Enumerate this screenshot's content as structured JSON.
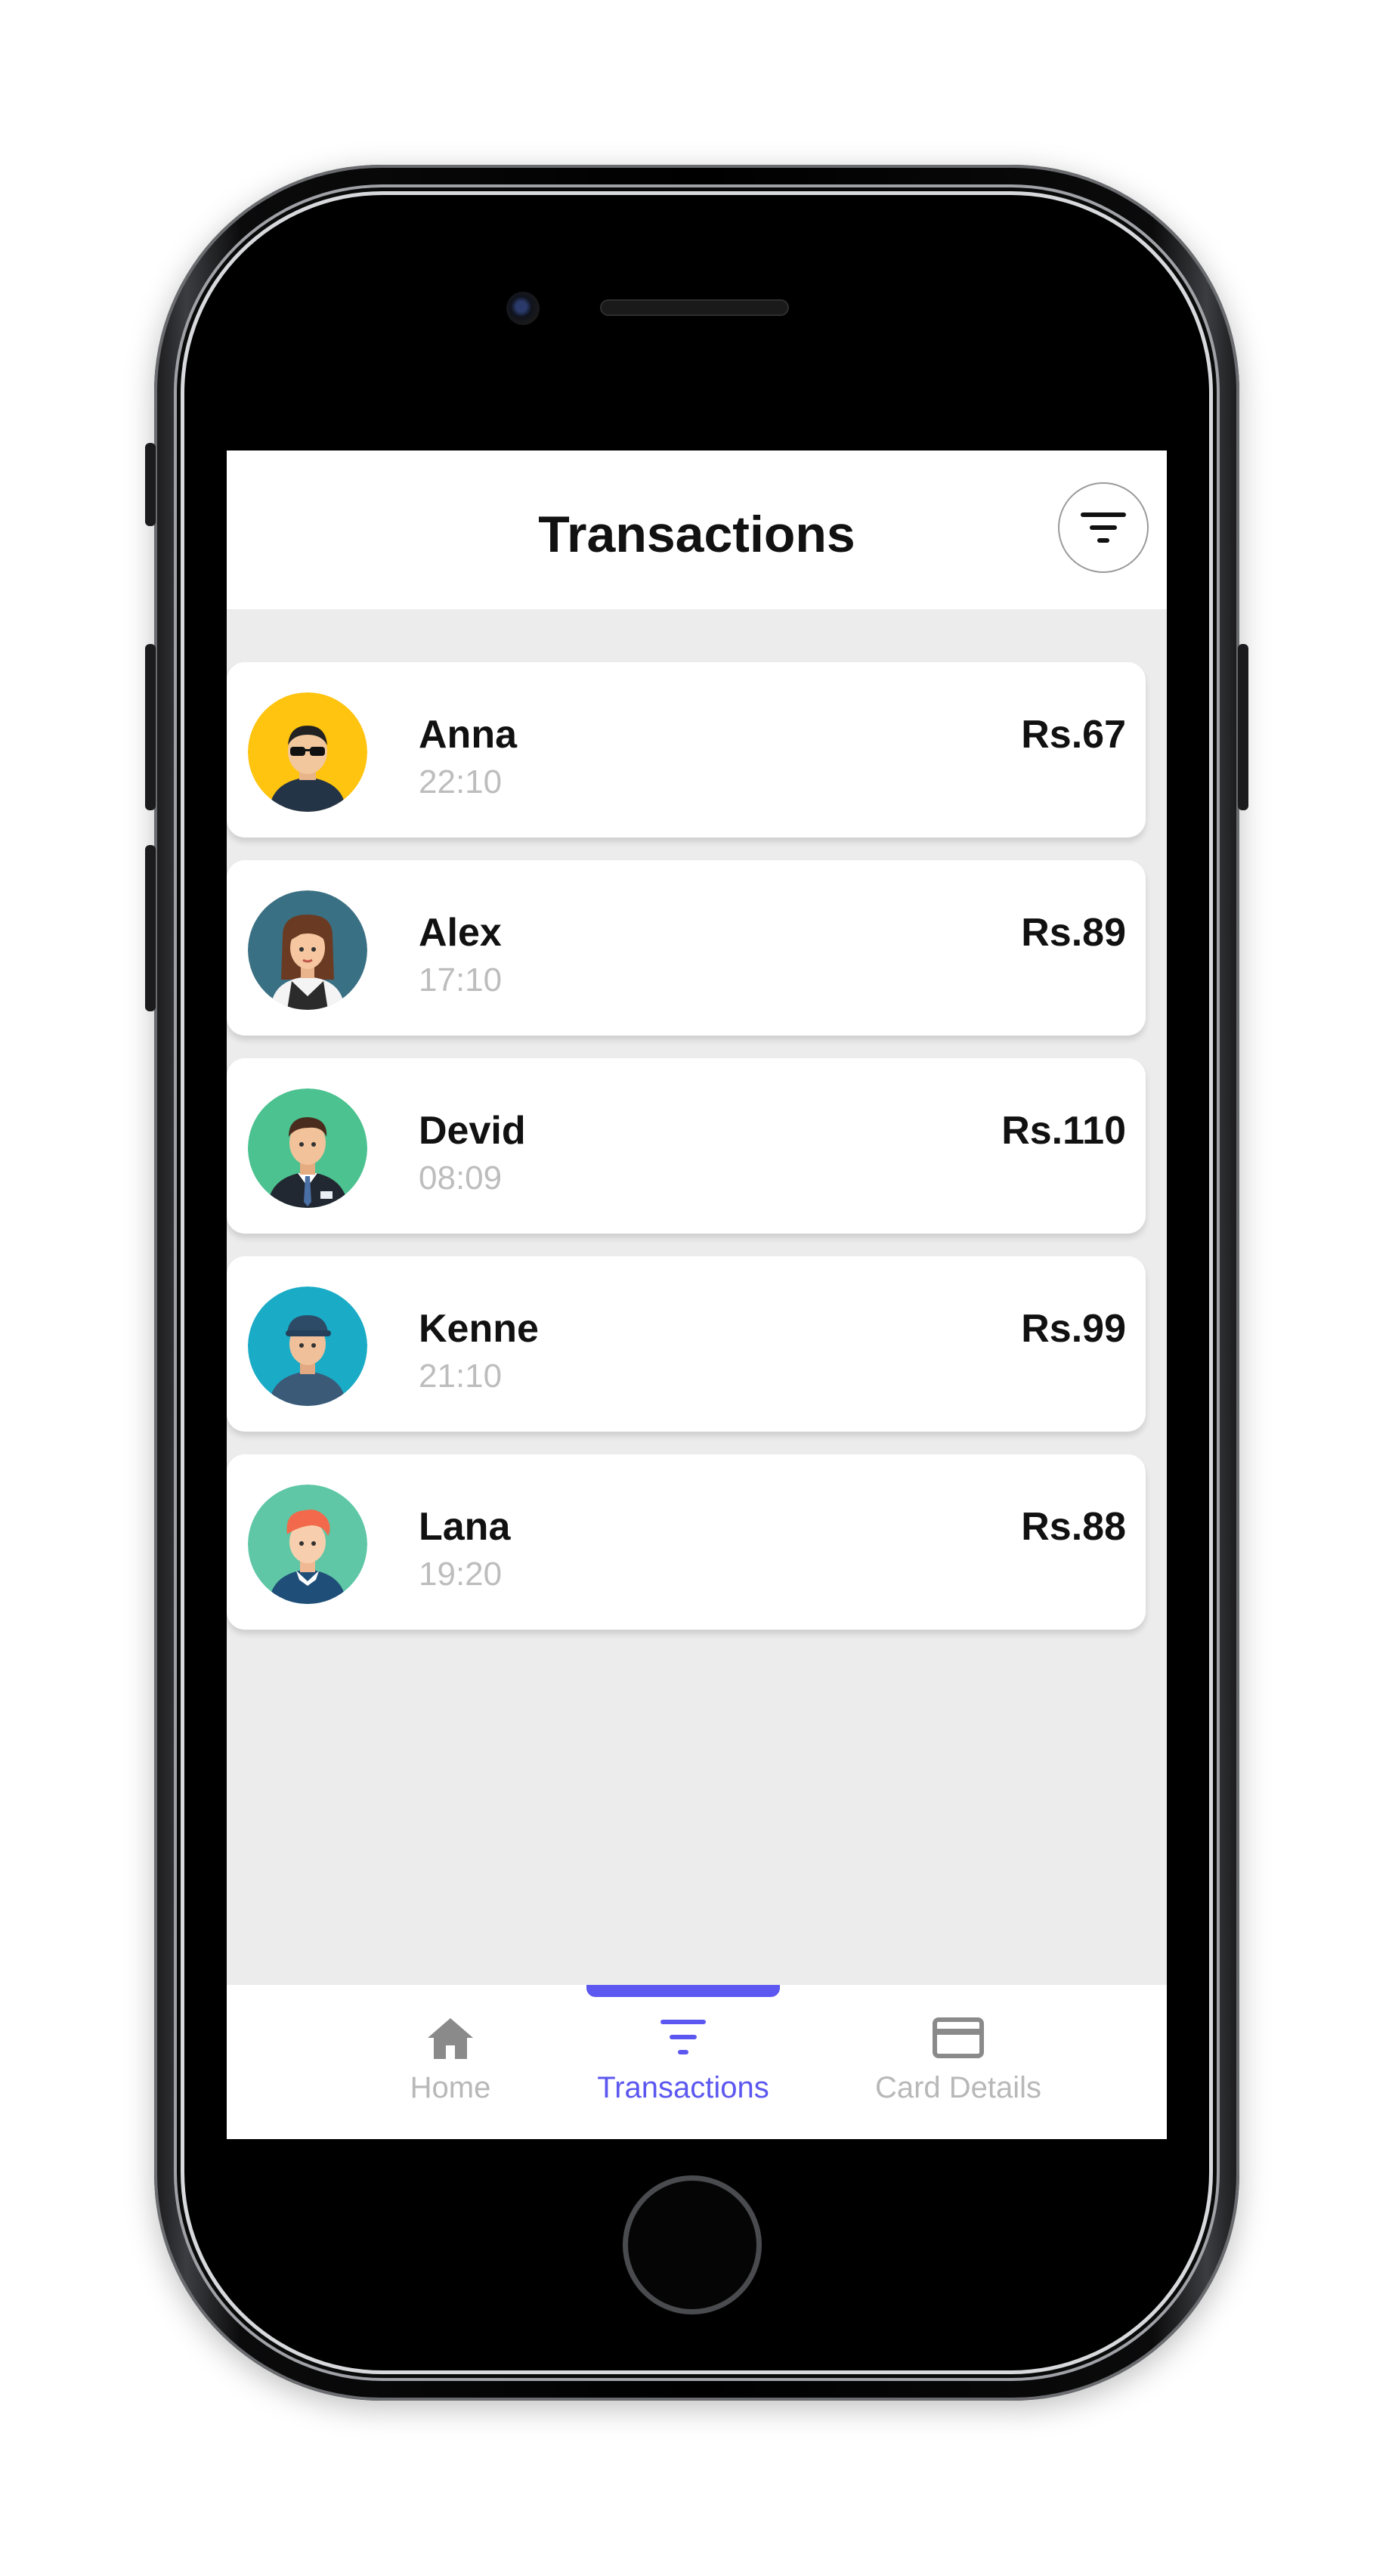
{
  "header": {
    "title": "Transactions"
  },
  "transactions": [
    {
      "name": "Anna",
      "time": "22:10",
      "amount": "Rs.67",
      "avatar_bg": "#ffc40f"
    },
    {
      "name": "Alex",
      "time": "17:10",
      "amount": "Rs.89",
      "avatar_bg": "#3a7083"
    },
    {
      "name": "Devid",
      "time": "08:09",
      "amount": "Rs.110",
      "avatar_bg": "#4cc290"
    },
    {
      "name": "Kenne",
      "time": "21:10",
      "amount": "Rs.99",
      "avatar_bg": "#1aabc6"
    },
    {
      "name": "Lana",
      "time": "19:20",
      "amount": "Rs.88",
      "avatar_bg": "#5fc7a5"
    }
  ],
  "nav": {
    "items": [
      {
        "label": "Home",
        "icon": "home-icon"
      },
      {
        "label": "Transactions",
        "icon": "filter-icon"
      },
      {
        "label": "Card Details",
        "icon": "credit-card-icon"
      }
    ],
    "active_index": 1
  },
  "colors": {
    "accent": "#5b57f0",
    "inactive": "#b8b8b8"
  }
}
